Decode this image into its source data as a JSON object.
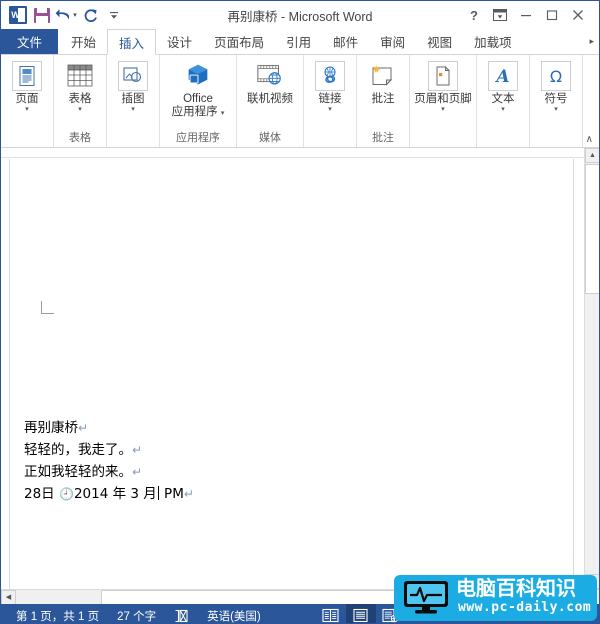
{
  "window": {
    "title": "再别康桥 - Microsoft Word",
    "quick_access": [
      {
        "name": "word-logo",
        "label": "W"
      },
      {
        "name": "save",
        "label": "保存"
      },
      {
        "name": "undo",
        "label": "撤消"
      },
      {
        "name": "redo",
        "label": "重复"
      },
      {
        "name": "customize-qat",
        "label": "自定义快速访问工具栏"
      }
    ],
    "controls": {
      "help": "?",
      "ribbon_display": "功能区显示选项",
      "minimize": "最小化",
      "restore": "向下还原",
      "close": "关闭"
    }
  },
  "tabs": [
    {
      "label": "文件",
      "kind": "file"
    },
    {
      "label": "开始",
      "kind": "normal"
    },
    {
      "label": "插入",
      "kind": "active"
    },
    {
      "label": "设计",
      "kind": "normal"
    },
    {
      "label": "页面布局",
      "kind": "normal"
    },
    {
      "label": "引用",
      "kind": "normal"
    },
    {
      "label": "邮件",
      "kind": "normal"
    },
    {
      "label": "审阅",
      "kind": "normal"
    },
    {
      "label": "视图",
      "kind": "normal"
    },
    {
      "label": "加载项",
      "kind": "normal"
    }
  ],
  "tab_overflow_label": "▸",
  "ribbon": {
    "collapse_label": "∧",
    "groups": [
      {
        "label": "",
        "items": [
          {
            "label": "页面",
            "icon": "pages-icon",
            "has_caret": true
          }
        ]
      },
      {
        "label": "表格",
        "items": [
          {
            "label": "表格",
            "icon": "table-icon",
            "has_caret": true
          }
        ]
      },
      {
        "label": "",
        "items": [
          {
            "label": "插图",
            "icon": "illustrations-icon",
            "has_caret": true
          }
        ]
      },
      {
        "label": "应用程序",
        "items": [
          {
            "label_line1": "Office",
            "label_line2": "应用程序",
            "icon": "office-apps-icon",
            "inline_caret": true
          }
        ]
      },
      {
        "label": "媒体",
        "items": [
          {
            "label": "联机视频",
            "icon": "online-video-icon",
            "has_caret": false
          }
        ]
      },
      {
        "label": "",
        "items": [
          {
            "label": "链接",
            "icon": "link-icon",
            "has_caret": true
          }
        ]
      },
      {
        "label": "批注",
        "items": [
          {
            "label": "批注",
            "icon": "comment-icon",
            "has_caret": false
          }
        ]
      },
      {
        "label": "",
        "items": [
          {
            "label": "页眉和页脚",
            "icon": "header-footer-icon",
            "has_caret": true
          }
        ]
      },
      {
        "label": "",
        "items": [
          {
            "label": "文本",
            "icon": "text-icon",
            "has_caret": true
          }
        ]
      },
      {
        "label": "",
        "items": [
          {
            "label": "符号",
            "icon": "symbol-icon",
            "has_caret": true
          }
        ]
      }
    ]
  },
  "document": {
    "lines": [
      {
        "text": "再别康桥",
        "mark": "↵"
      },
      {
        "text": "轻轻的，我走了。",
        "mark": "↵"
      },
      {
        "text": "正如我轻轻的来。",
        "mark": "↵"
      },
      {
        "prefix": "28日  ",
        "clock": "🕘",
        "text": "2014 年 3 月",
        "suffix": " PM",
        "mark": "↵",
        "has_caret": true
      }
    ]
  },
  "scrollbars": {
    "vertical": {
      "up": "▲",
      "down": "▼"
    },
    "horizontal": {
      "left": "◀",
      "right": "▶"
    }
  },
  "statusbar": {
    "page_info": "第 1 页，共 1 页",
    "word_count": "27 个字",
    "proofing_icon": "proofing-errors-icon",
    "language": "英语(美国)",
    "views": [
      {
        "name": "read-mode-view",
        "icon": "read-mode-icon",
        "active": false
      },
      {
        "name": "print-layout-view",
        "icon": "print-layout-icon",
        "active": true
      },
      {
        "name": "web-layout-view",
        "icon": "web-layout-icon",
        "active": false
      }
    ]
  },
  "watermark": {
    "title": "电脑百科知识",
    "url": "www.pc-daily.com",
    "color": "#1bace3"
  },
  "colors": {
    "office_blue": "#2b579a",
    "accent_blue": "#2a5699",
    "ribbon_bg": "#ffffff",
    "border": "#d4d4d4"
  }
}
